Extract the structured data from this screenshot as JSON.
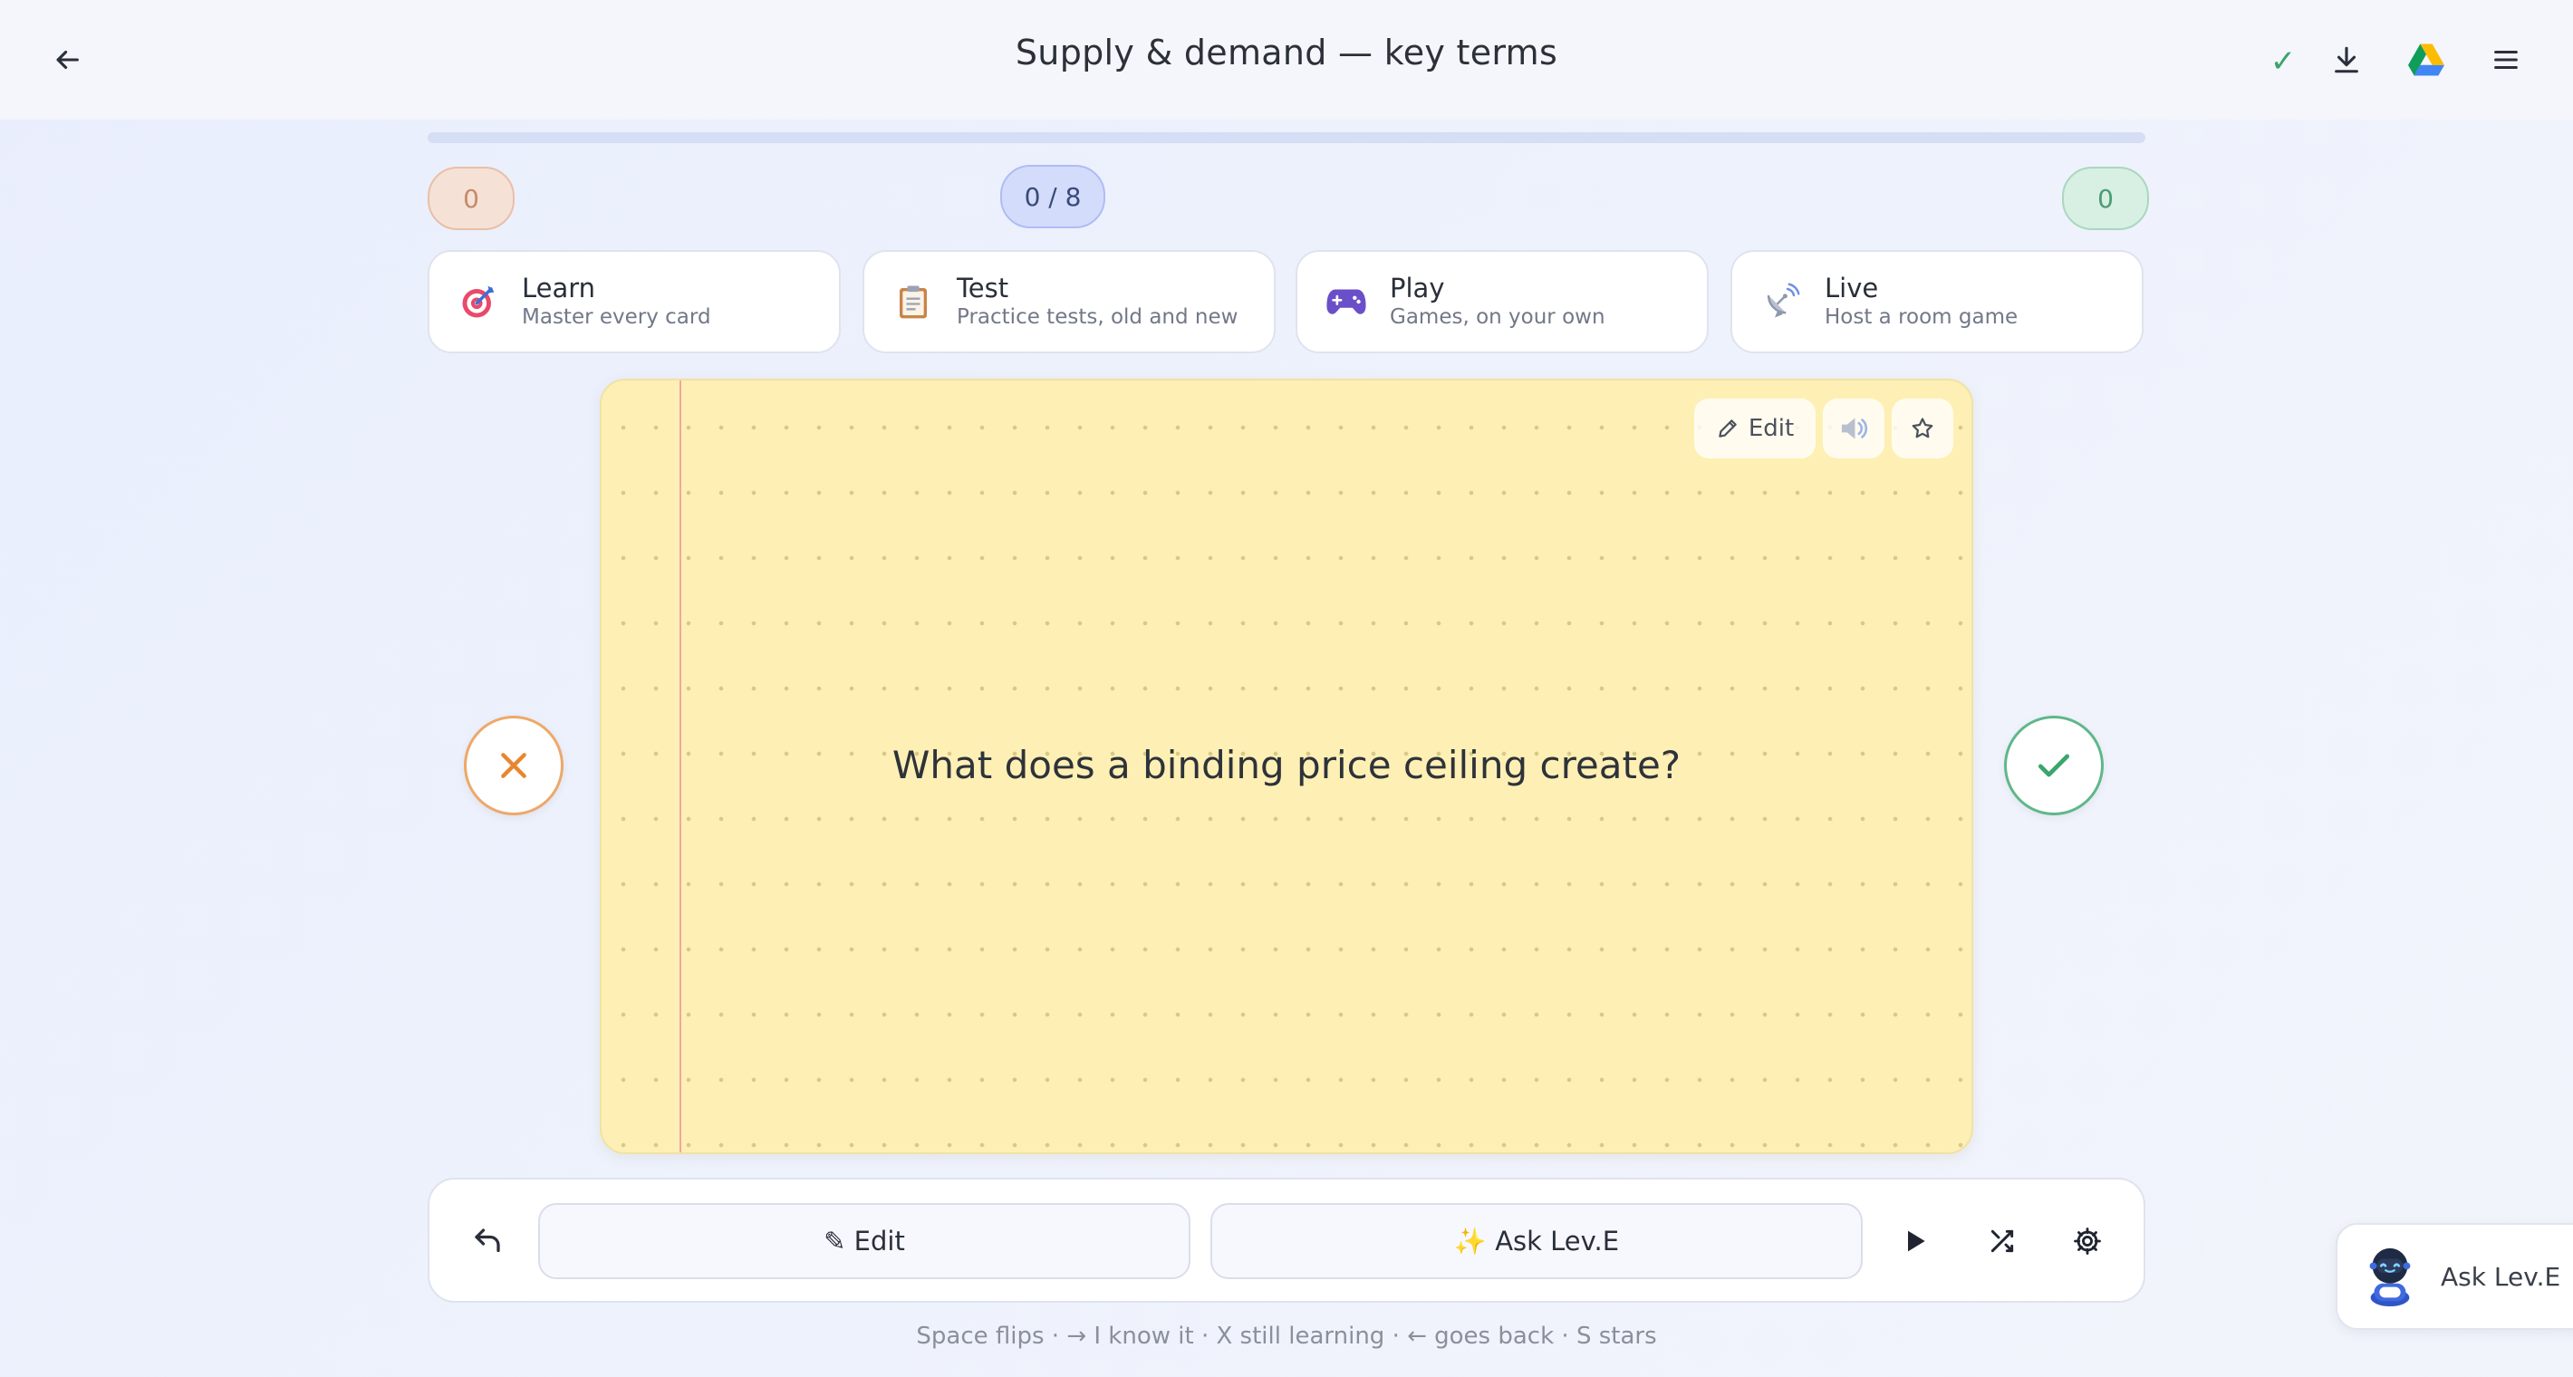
{
  "header": {
    "title": "Supply & demand — key terms",
    "back_icon": "arrow-left-icon",
    "saved_mark": "✓",
    "actions": [
      "download-icon",
      "google-drive-icon",
      "menu-icon"
    ]
  },
  "progress": {
    "fraction": 0.0
  },
  "counters": {
    "still_learning": "0",
    "position": "0 / 8",
    "known": "0"
  },
  "modes": [
    {
      "title": "Learn",
      "subtitle": "Master every card",
      "icon": "target-icon"
    },
    {
      "title": "Test",
      "subtitle": "Practice tests, old and new",
      "icon": "clipboard-icon"
    },
    {
      "title": "Play",
      "subtitle": "Games, on your own",
      "icon": "gamepad-icon"
    },
    {
      "title": "Live",
      "subtitle": "Host a room game",
      "icon": "satellite-dish-icon"
    }
  ],
  "card": {
    "question": "What does a binding price ceiling create?",
    "edit_label": "Edit"
  },
  "toolbar": {
    "edit_label": "✎ Edit",
    "ask_label": "✨ Ask Lev.E"
  },
  "hint": "Space flips · → I know it · X still learning · ← goes back · S stars",
  "assistant": {
    "label": "Ask Lev.E"
  },
  "colors": {
    "accent": "#7e95e6",
    "card": "#fef0b4",
    "wrong": "#e8862f",
    "right": "#3aa56e"
  }
}
